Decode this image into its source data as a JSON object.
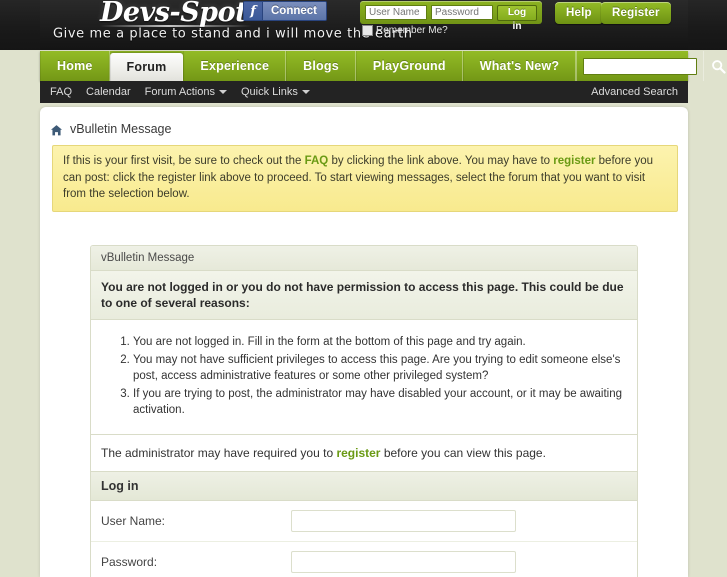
{
  "site": {
    "logo": "Devs-Spot",
    "tagline": "Give me a place to stand and i will move the earth"
  },
  "facebook": {
    "f_glyph": "f",
    "connect_label": "Connect"
  },
  "login_bar": {
    "username_placeholder": "User Name",
    "username_value": "",
    "password_placeholder": "Password",
    "password_value": "",
    "login_label": "Log in",
    "remember_label": "Remember Me?"
  },
  "top_buttons": {
    "help": "Help",
    "register": "Register"
  },
  "nav": {
    "tabs": [
      {
        "label": "Home",
        "active": false
      },
      {
        "label": "Forum",
        "active": true
      },
      {
        "label": "Experience",
        "active": false
      },
      {
        "label": "Blogs",
        "active": false
      },
      {
        "label": "PlayGround",
        "active": false
      },
      {
        "label": "What's New?",
        "active": false
      }
    ],
    "search_placeholder": "",
    "search_value": "",
    "search_icon": "search-icon"
  },
  "subnav": {
    "items": [
      {
        "label": "FAQ",
        "caret": false
      },
      {
        "label": "Calendar",
        "caret": false
      },
      {
        "label": "Forum Actions",
        "caret": true
      },
      {
        "label": "Quick Links",
        "caret": true
      }
    ],
    "advanced_search": "Advanced Search"
  },
  "breadcrumb": {
    "home_icon": "home-icon",
    "text": "vBulletin Message"
  },
  "notice": {
    "part1": "If this is your first visit, be sure to check out the ",
    "faq_link": "FAQ",
    "part2": " by clicking the link above. You may have to ",
    "register_link": "register",
    "part3": " before you can post: click the register link above to proceed. To start viewing messages, select the forum that you want to visit from the selection below."
  },
  "panel": {
    "title": "vBulletin Message",
    "heading": "You are not logged in or you do not have permission to access this page. This could be due to one of several reasons:",
    "reasons": [
      "You are not logged in. Fill in the form at the bottom of this page and try again.",
      "You may not have sufficient privileges to access this page. Are you trying to edit someone else's post, access administrative features or some other privileged system?",
      "If you are trying to post, the administrator may have disabled your account, or it may be awaiting activation."
    ],
    "admin_note_part1": "The administrator may have required you to ",
    "admin_note_link": "register",
    "admin_note_part2": " before you can view this page.",
    "login_header": "Log in",
    "fields": [
      {
        "label": "User Name:",
        "value": "",
        "type": "text"
      },
      {
        "label": "Password:",
        "value": "",
        "type": "password"
      }
    ]
  },
  "colors": {
    "page_background": "#dfe2cd",
    "header_black": "#1e1e1e",
    "nav_green": "#8db322",
    "accent_link_green": "#6a9a14",
    "notice_yellow": "#fbf0a0",
    "facebook_blue": "#3b5998",
    "panel_border": "#d9dcc8"
  }
}
